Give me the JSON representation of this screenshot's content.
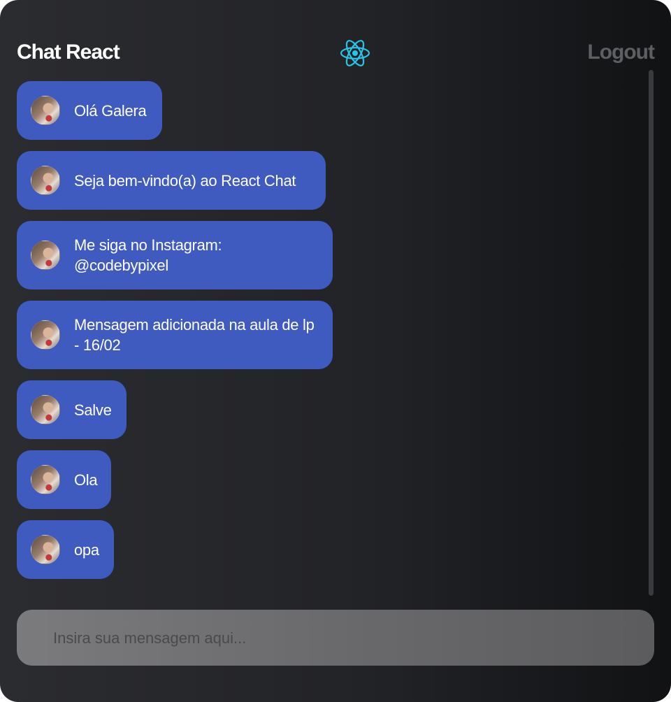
{
  "header": {
    "title": "Chat React",
    "logo_icon": "react-atom-icon",
    "logout_label": "Logout"
  },
  "messages": [
    {
      "text": "Olá Galera"
    },
    {
      "text": "Seja bem-vindo(a) ao React Chat"
    },
    {
      "text": "Me siga no Instagram: @codebypixel"
    },
    {
      "text": "Mensagem adicionada na aula de lp - 16/02"
    },
    {
      "text": "Salve"
    },
    {
      "text": "Ola"
    },
    {
      "text": "opa"
    }
  ],
  "composer": {
    "placeholder": "Insira sua mensagem aqui..."
  },
  "colors": {
    "bubble": "#3f5bc0",
    "react_logo": "#29c5e6",
    "logout": "#5e5f63"
  }
}
